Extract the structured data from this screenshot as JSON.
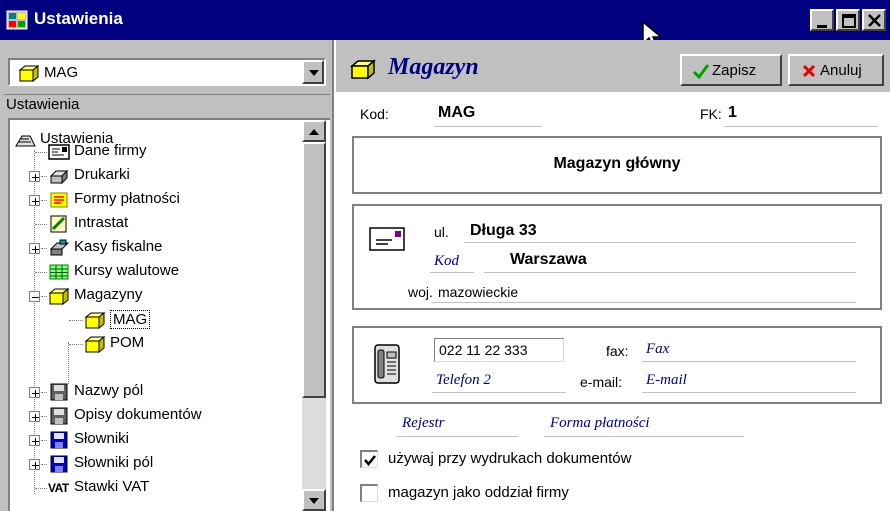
{
  "window": {
    "title": "Ustawienia",
    "buttons": [
      "minimize",
      "maximize",
      "close"
    ]
  },
  "left_panel": {
    "combo_value": "MAG",
    "section_label": "Ustawienia",
    "tree": {
      "root": "Ustawienia",
      "items": [
        {
          "label": "Dane firmy",
          "icon": "company-card-icon"
        },
        {
          "label": "Drukarki",
          "icon": "printer-icon"
        },
        {
          "label": "Formy płatności",
          "icon": "payment-icon"
        },
        {
          "label": "Intrastat",
          "icon": "intrastat-icon"
        },
        {
          "label": "Kasy fiskalne",
          "icon": "cash-register-icon"
        },
        {
          "label": "Kursy walutowe",
          "icon": "grid-table-icon"
        },
        {
          "label": "Magazyny",
          "icon": "warehouse-box-icon"
        },
        {
          "label": "MAG",
          "icon": "warehouse-box-icon"
        },
        {
          "label": "POM",
          "icon": "warehouse-box-icon"
        },
        {
          "label": "Nazwy pól",
          "icon": "disk-gray-icon"
        },
        {
          "label": "Opisy dokumentów",
          "icon": "disk-gray-icon"
        },
        {
          "label": "Słowniki",
          "icon": "disk-blue-icon"
        },
        {
          "label": "Słowniki pól",
          "icon": "disk-blue-icon"
        },
        {
          "label": "Stawki VAT",
          "icon": "vat-icon"
        }
      ],
      "vat_badge": "VAT"
    }
  },
  "right_panel": {
    "title": "Magazyn",
    "save_label": "Zapisz",
    "cancel_label": "Anuluj",
    "kod_label": "Kod:",
    "kod_value": "MAG",
    "fk_label": "FK:",
    "fk_value": "1",
    "name": "Magazyn główny",
    "address": {
      "street_label": "ul.",
      "street_value": "Długa 33",
      "postcode_placeholder": "Kod",
      "city_value": "Warszawa",
      "voivodeship_label": "woj.",
      "voivodeship_value": "mazowieckie"
    },
    "contact": {
      "phone1_value": "022 11 22 333",
      "fax_label": "fax:",
      "fax_placeholder": "Fax",
      "phone2_placeholder": "Telefon 2",
      "email_label": "e-mail:",
      "email_placeholder": "E-mail"
    },
    "register_placeholder": "Rejestr",
    "payment_form_placeholder": "Forma płatności",
    "checkboxes": [
      {
        "label": "używaj przy wydrukach dokumentów",
        "checked": true
      },
      {
        "label": "magazyn jako oddział firmy",
        "checked": false
      }
    ]
  }
}
